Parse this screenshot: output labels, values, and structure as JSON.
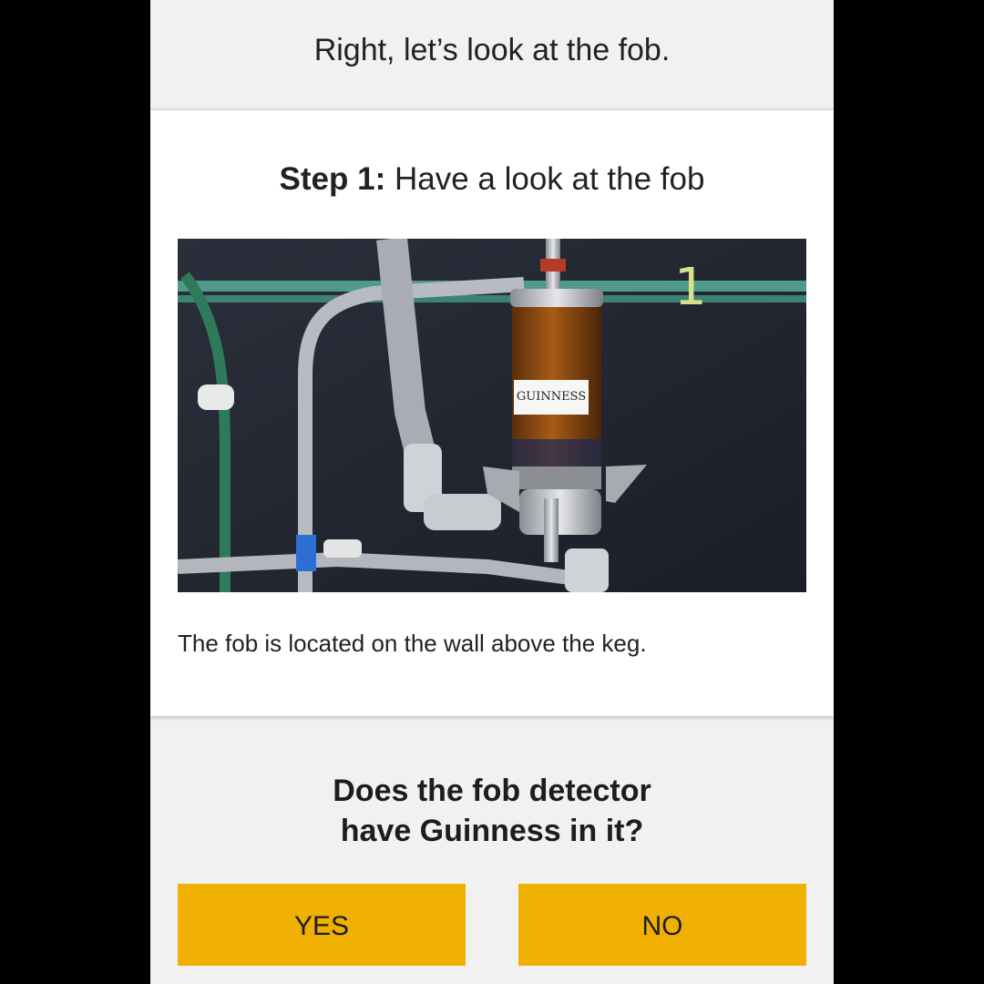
{
  "header": {
    "title": "Right, let’s look at the fob."
  },
  "step": {
    "label_bold": "Step 1:",
    "label_text": " Have a look at the fob",
    "photo_label_text": "GUINNESS",
    "photo_number": "1",
    "caption": "The fob is located on the wall above the keg."
  },
  "question": {
    "line1": "Does the fob detector",
    "line2": "have Guinness in it?"
  },
  "buttons": {
    "yes": "YES",
    "no": "NO"
  },
  "colors": {
    "accent": "#f0b001",
    "background": "#f1f1f1",
    "card": "#ffffff"
  }
}
